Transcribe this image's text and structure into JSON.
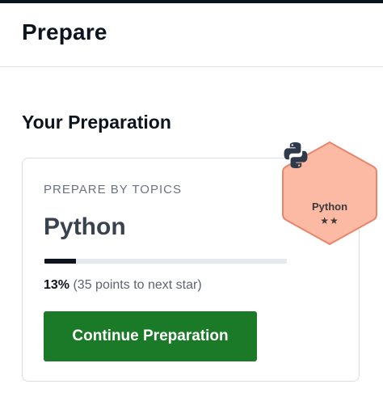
{
  "header": {
    "title": "Prepare"
  },
  "preparation": {
    "section_title": "Your Preparation",
    "card": {
      "eyebrow": "PREPARE BY TOPICS",
      "topic": "Python",
      "progress_fraction": 0.13,
      "progress_percent": "13%",
      "progress_detail": " (35 points to next star)",
      "cta_label": "Continue Preparation"
    },
    "badge": {
      "label": "Python",
      "stars": "★★",
      "icon": "python-logo-icon",
      "fill_color": "#fcb9a4",
      "stroke_color": "#e8856b"
    }
  },
  "colors": {
    "accent_dark": "#0e141e",
    "button_green": "#1a7a27",
    "progress_track": "#e4e9ee"
  }
}
